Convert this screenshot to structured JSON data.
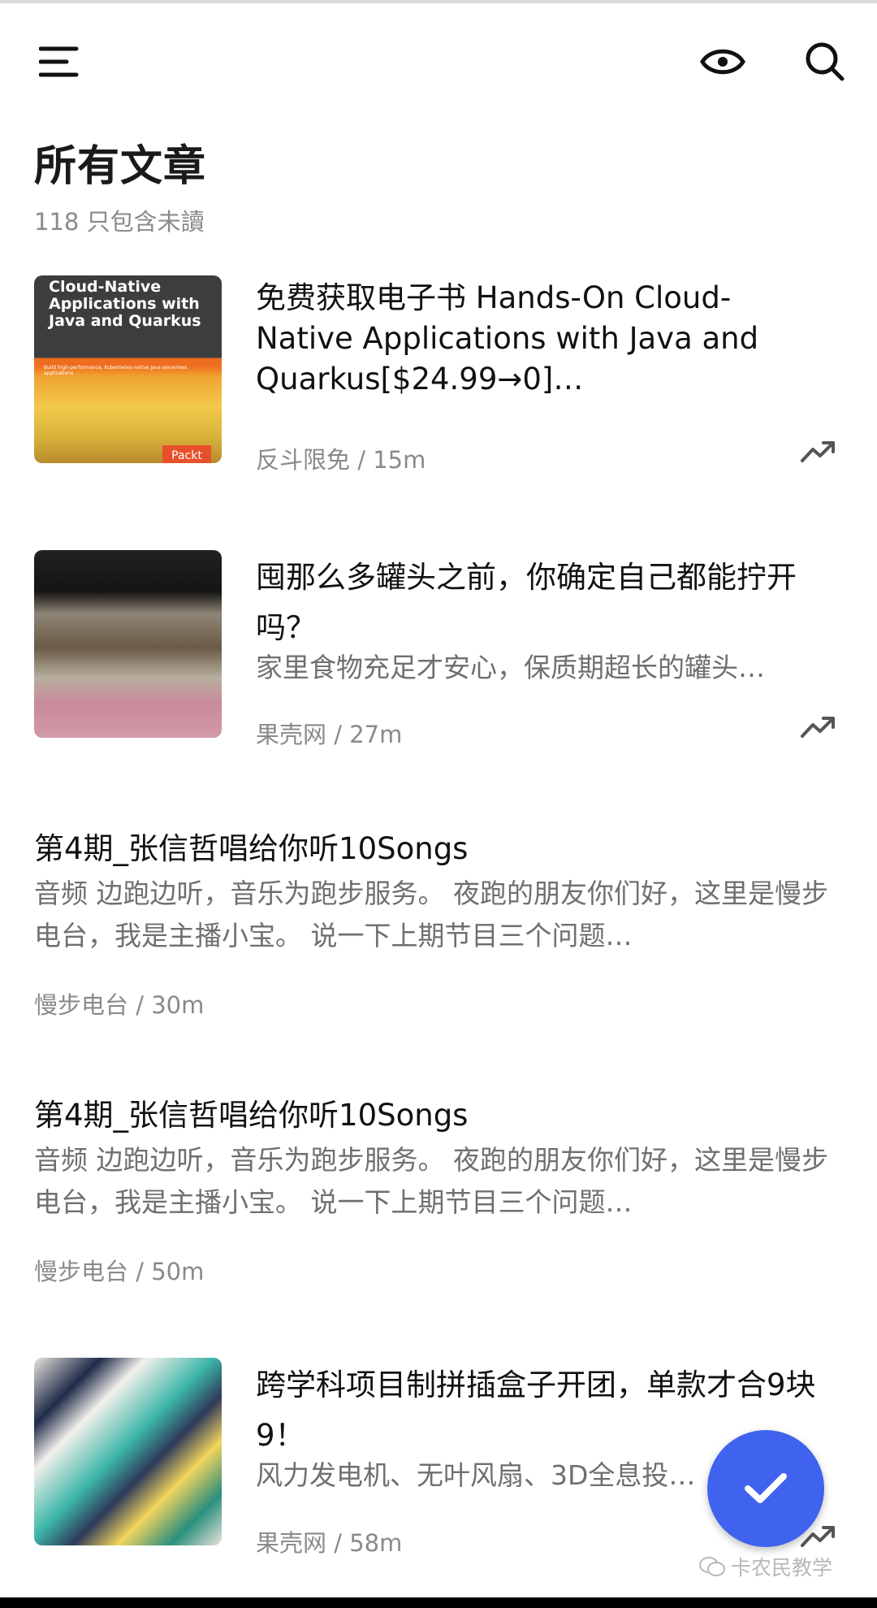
{
  "page": {
    "title": "所有文章",
    "subtitle": "118 只包含未讀"
  },
  "toolbar": {
    "menu_icon": "menu-icon",
    "eye_icon": "eye-icon",
    "search_icon": "search-icon"
  },
  "articles": [
    {
      "title": "免费获取电子书 Hands-On Cloud-Native Applications with Java and Quarkus[$24.99→0]…",
      "excerpt": "",
      "meta": "反斗限免 / 15m",
      "thumbnail": {
        "book_title": "Cloud-Native Applications with Java and Quarkus",
        "book_tagline": "Build high-performance, Kubernetes-native Java serverless applications",
        "publisher": "Packt"
      }
    },
    {
      "title": "囤那么多罐头之前，你确定自己都能拧开吗？",
      "excerpt": "家里食物充足才安心，保质期超长的罐头…",
      "meta": "果壳网 / 27m"
    },
    {
      "title": "第4期_张信哲唱给你听10Songs",
      "excerpt": "音频   边跑边听，音乐为跑步服务。  夜跑的朋友你们好，这里是慢步电台，我是主播小宝。   说一下上期节目三个问题…",
      "meta": "慢步电台 / 30m"
    },
    {
      "title": "第4期_张信哲唱给你听10Songs",
      "excerpt": "音频   边跑边听，音乐为跑步服务。  夜跑的朋友你们好，这里是慢步电台，我是主播小宝。   说一下上期节目三个问题…",
      "meta": "慢步电台 / 50m"
    },
    {
      "title": "跨学科项目制拼插盒子开团，单款才合9块9！",
      "excerpt": "风力发电机、无叶风扇、3D全息投…",
      "meta": "果壳网 / 58m"
    }
  ],
  "fab": {
    "icon": "checkmark-icon",
    "color": "#3f63ef"
  },
  "watermark": "卡农民教学",
  "colors": {
    "accent": "#3f63ef",
    "muted_text": "#8a8a8a"
  }
}
